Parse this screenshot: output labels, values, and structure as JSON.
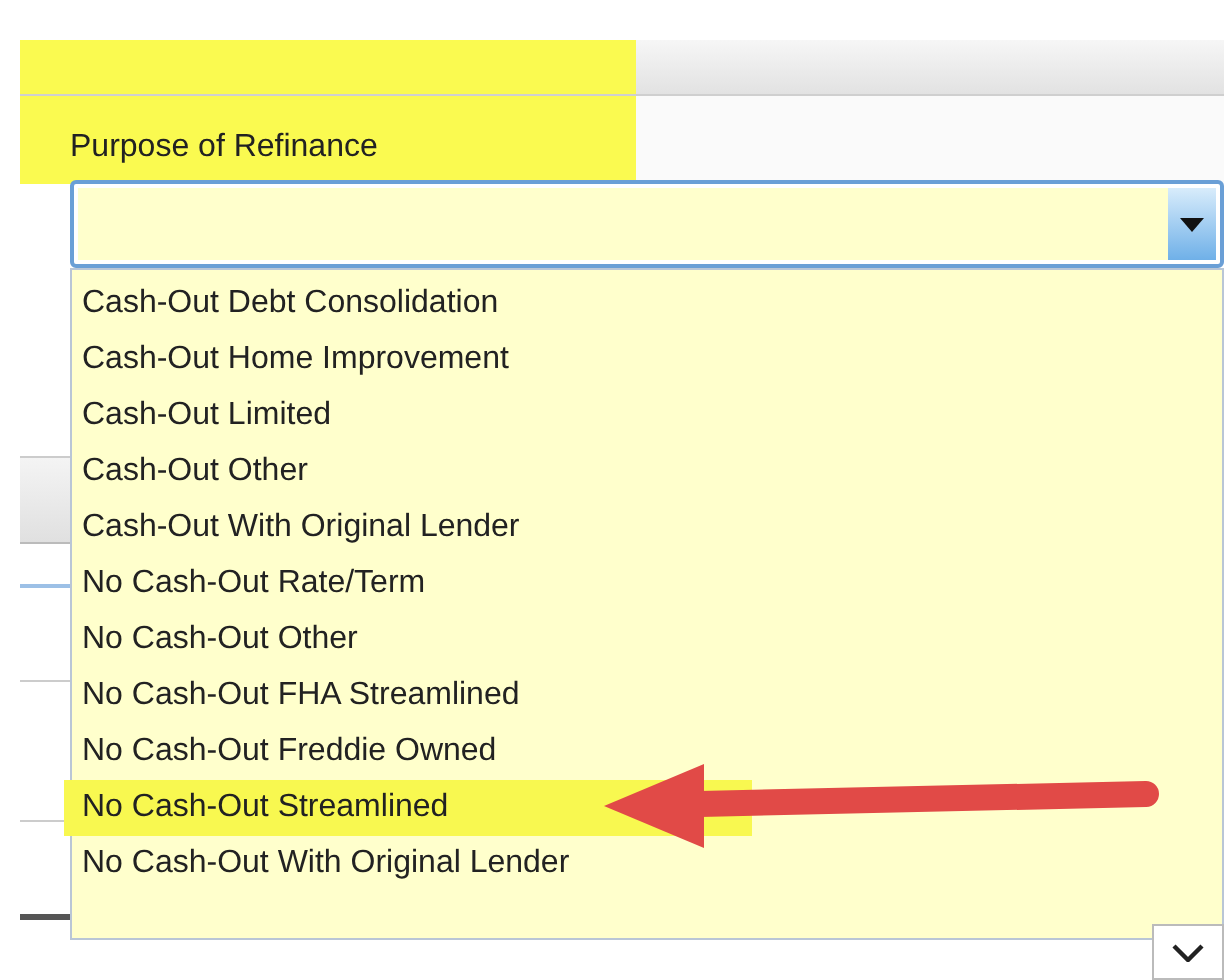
{
  "field": {
    "label": "Purpose of Refinance",
    "label_highlighted": true
  },
  "options": [
    {
      "text": "Cash-Out Debt Consolidation",
      "highlighted": false
    },
    {
      "text": "Cash-Out Home Improvement",
      "highlighted": false
    },
    {
      "text": "Cash-Out Limited",
      "highlighted": false
    },
    {
      "text": "Cash-Out Other",
      "highlighted": false
    },
    {
      "text": "Cash-Out With Original Lender",
      "highlighted": false
    },
    {
      "text": "No Cash-Out Rate/Term",
      "highlighted": false
    },
    {
      "text": "No Cash-Out Other",
      "highlighted": false
    },
    {
      "text": "No Cash-Out FHA Streamlined",
      "highlighted": false
    },
    {
      "text": "No Cash-Out Freddie Owned",
      "highlighted": false
    },
    {
      "text": "No Cash-Out Streamlined",
      "highlighted": true
    },
    {
      "text": "No Cash-Out With Original Lender",
      "highlighted": false
    }
  ]
}
